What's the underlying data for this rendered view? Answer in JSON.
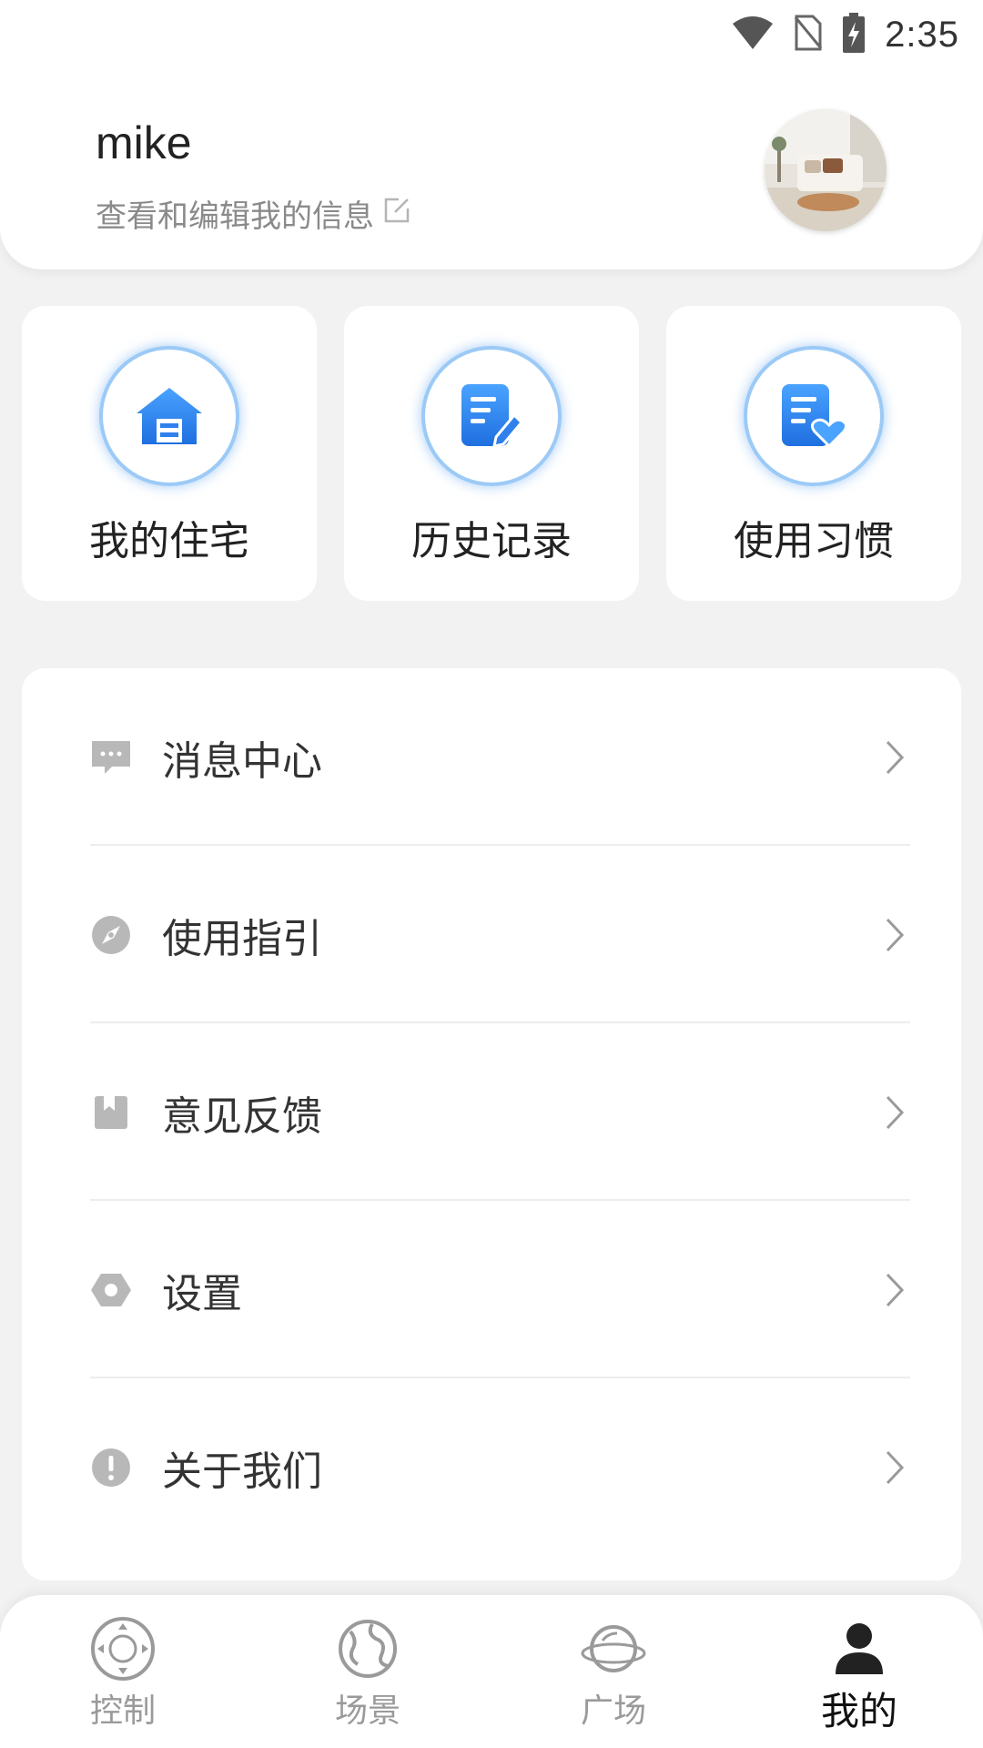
{
  "status_bar": {
    "time": "2:35",
    "icons": [
      "wifi-icon",
      "no-sim-icon",
      "battery-charging-icon"
    ]
  },
  "profile": {
    "username": "mike",
    "edit_link": "查看和编辑我的信息",
    "edit_icon": "edit-icon",
    "avatar": "living-room-avatar"
  },
  "quick_actions": [
    {
      "label": "我的住宅",
      "icon": "house-icon"
    },
    {
      "label": "历史记录",
      "icon": "document-edit-icon"
    },
    {
      "label": "使用习惯",
      "icon": "document-heart-icon"
    }
  ],
  "menu": [
    {
      "label": "消息中心",
      "icon": "message-icon"
    },
    {
      "label": "使用指引",
      "icon": "compass-icon"
    },
    {
      "label": "意见反馈",
      "icon": "bookmark-icon"
    },
    {
      "label": "设置",
      "icon": "settings-icon"
    },
    {
      "label": "关于我们",
      "icon": "info-icon"
    }
  ],
  "bottom_nav": [
    {
      "label": "控制",
      "icon": "control-icon",
      "active": false
    },
    {
      "label": "场景",
      "icon": "globe-icon",
      "active": false
    },
    {
      "label": "广场",
      "icon": "planet-icon",
      "active": false
    },
    {
      "label": "我的",
      "icon": "person-icon",
      "active": true
    }
  ],
  "colors": {
    "accent": "#2f80ed",
    "accent_glow": "#9ccaf6",
    "background": "#f2f2f2",
    "menu_icon": "#b8b8b8",
    "nav_inactive": "#9a9a9a",
    "nav_active": "#111111"
  }
}
